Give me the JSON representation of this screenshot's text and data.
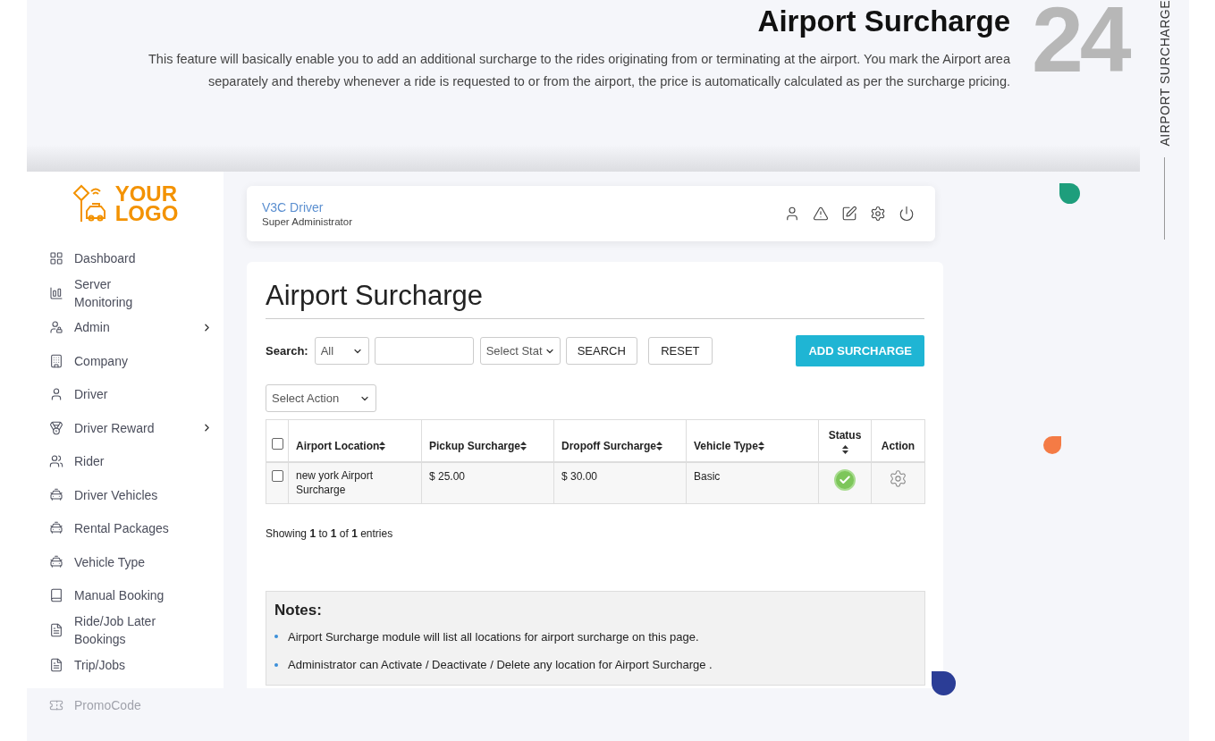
{
  "intro": {
    "title": "Airport Surcharge",
    "description": "This feature will basically enable you to add an additional surcharge to the rides originating from or terminating at the airport. You mark the Airport area separately and thereby whenever a ride is requested to or from the airport, the price is automatically calculated as per the surcharge pricing.",
    "number": "24",
    "side_label": "AIRPORT SURCHARGE"
  },
  "sidebar": {
    "logo": [
      "YOUR",
      "LOGO"
    ],
    "items": [
      {
        "label": "Dashboard",
        "has_submenu": false,
        "faded": false
      },
      {
        "label": "Server Monitoring",
        "has_submenu": false,
        "faded": false
      },
      {
        "label": "Admin",
        "has_submenu": true,
        "faded": false
      },
      {
        "label": "Company",
        "has_submenu": false,
        "faded": false
      },
      {
        "label": "Driver",
        "has_submenu": false,
        "faded": false
      },
      {
        "label": "Driver Reward",
        "has_submenu": true,
        "faded": false
      },
      {
        "label": "Rider",
        "has_submenu": false,
        "faded": false
      },
      {
        "label": "Driver Vehicles",
        "has_submenu": false,
        "faded": false
      },
      {
        "label": "Rental Packages",
        "has_submenu": false,
        "faded": false
      },
      {
        "label": "Vehicle Type",
        "has_submenu": false,
        "faded": false
      },
      {
        "label": "Manual Booking",
        "has_submenu": false,
        "faded": false
      },
      {
        "label": "Ride/Job Later Bookings",
        "has_submenu": false,
        "faded": false
      },
      {
        "label": "Trip/Jobs",
        "has_submenu": false,
        "faded": false
      },
      {
        "label": "PromoCode",
        "has_submenu": false,
        "faded": true
      }
    ]
  },
  "header": {
    "user_name": "V3C Driver",
    "role": "Super Administrator"
  },
  "page": {
    "title": "Airport Surcharge",
    "search_label": "Search:",
    "filter_select": "All",
    "status_select": "Select Stat",
    "search_button": "SEARCH",
    "reset_button": "RESET",
    "add_button": "ADD SURCHARGE",
    "action_select": "Select Action"
  },
  "table": {
    "all_selected": false,
    "columns": [
      {
        "label": "Airport Location",
        "sortable": true
      },
      {
        "label": "Pickup Surcharge",
        "sortable": true
      },
      {
        "label": "Dropoff Surcharge",
        "sortable": true
      },
      {
        "label": "Vehicle Type",
        "sortable": true
      },
      {
        "label": "Status",
        "sortable": true
      },
      {
        "label": "Action",
        "sortable": false
      }
    ],
    "rows": [
      {
        "selected": false,
        "location": "new york Airport Surcharge",
        "pickup": "$ 25.00",
        "dropoff": "$ 30.00",
        "vehicle_type": "Basic",
        "active": true
      }
    ]
  },
  "summary": "Showing **1** to **1** of **1** entries",
  "notes": {
    "title": "Notes:",
    "items": [
      "Airport Surcharge module will list all locations for airport surcharge on this page.",
      "Administrator can Activate / Deactivate / Delete any location for Airport Surcharge ."
    ]
  }
}
